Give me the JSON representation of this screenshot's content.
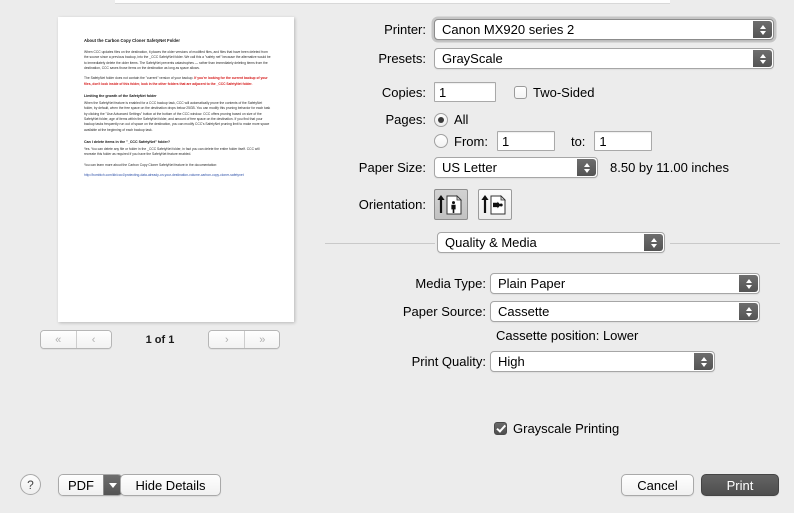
{
  "preview": {
    "document": {
      "title": "About the Carbon Copy Cloner SafetyNet Folder",
      "paragraph1": "When CCC updates files on the destination, it places the older versions of modified files, and files that have been deleted from the source since a previous backup, into the _CCC SafetyNet folder. We call this a \"safety net\" because the alternative would be to immediately delete the older items. The SafetyNet prevents catastrophes — rather than immediately deleting items from the destination, CCC saves those items on the destination as long as space allows.",
      "paragraph2_pre": "The SafetyNet folder does not contain the \"current\" version of your backup. ",
      "paragraph2_highlight": "If you're looking for the current backup of your files, don't look inside of this folder, look in the other folders that are adjacent to the _CCC SafetyNet folder.",
      "heading2": "Limiting the growth of the SafetyNet folder",
      "paragraph3": "When the SafetyNet feature is enabled for a CCC backup task, CCC will automatically prune the contents of the SafetyNet folder, by default, when the free space on the destination drops below 25GB. You can modify this pruning behavior for each task by clicking the \"Use Advanced Settings\" button at the bottom of the CCC window. CCC offers pruning based on size of the SafetyNet folder, age of items within the SafetyNet folder, and amount of free space on the destination. If you find that your backup tasks frequently run out of space on the destination, you can modify CCC's SafetyNet pruning limit to make more space available at the beginning of each backup task.",
      "heading3": "Can I delete items in the \"_CCC SafetyNet\" folder?",
      "paragraph4": "Yes. You can delete any file or folder in the _CCC SafetyNet folder, in fact you can delete the entire folder itself. CCC will recreate this folder as required if you have the SafetyNet feature enabled.",
      "paragraph5": "You can learn more about the Carbon Copy Cloner SafetyNet feature in the documentation:",
      "url": "http://bombich.com/kb/ccc4/protecting-data-already-on-your-destination-volume-carbon-copy-cloner-safetynet"
    },
    "pager": {
      "first_label": "«",
      "prev_label": "‹",
      "page_label": "1 of 1",
      "next_label": "›",
      "last_label": "»"
    }
  },
  "settings": {
    "printer_label": "Printer:",
    "printer_value": "Canon MX920 series 2",
    "presets_label": "Presets:",
    "presets_value": "GrayScale",
    "copies_label": "Copies:",
    "copies_value": "1",
    "two_sided_label": "Two-Sided",
    "two_sided_checked": false,
    "pages_label": "Pages:",
    "pages_all_label": "All",
    "pages_all_selected": true,
    "pages_from_label": "From:",
    "pages_from_value": "1",
    "pages_to_label": "to:",
    "pages_to_value": "1",
    "paper_size_label": "Paper Size:",
    "paper_size_value": "US Letter",
    "paper_dimensions": "8.50 by 11.00 inches",
    "orientation_label": "Orientation:",
    "orientation_portrait_selected": true,
    "orientation_landscape_selected": false,
    "pane_popup_value": "Quality & Media",
    "media_type_label": "Media Type:",
    "media_type_value": "Plain Paper",
    "paper_source_label": "Paper Source:",
    "paper_source_value": "Cassette",
    "cassette_position_note": "Cassette position: Lower",
    "print_quality_label": "Print Quality:",
    "print_quality_value": "High",
    "grayscale_label": "Grayscale Printing",
    "grayscale_checked": true
  },
  "bottom": {
    "help_label": "?",
    "pdf_label": "PDF",
    "hide_details_label": "Hide Details",
    "cancel_label": "Cancel",
    "print_label": "Print"
  }
}
